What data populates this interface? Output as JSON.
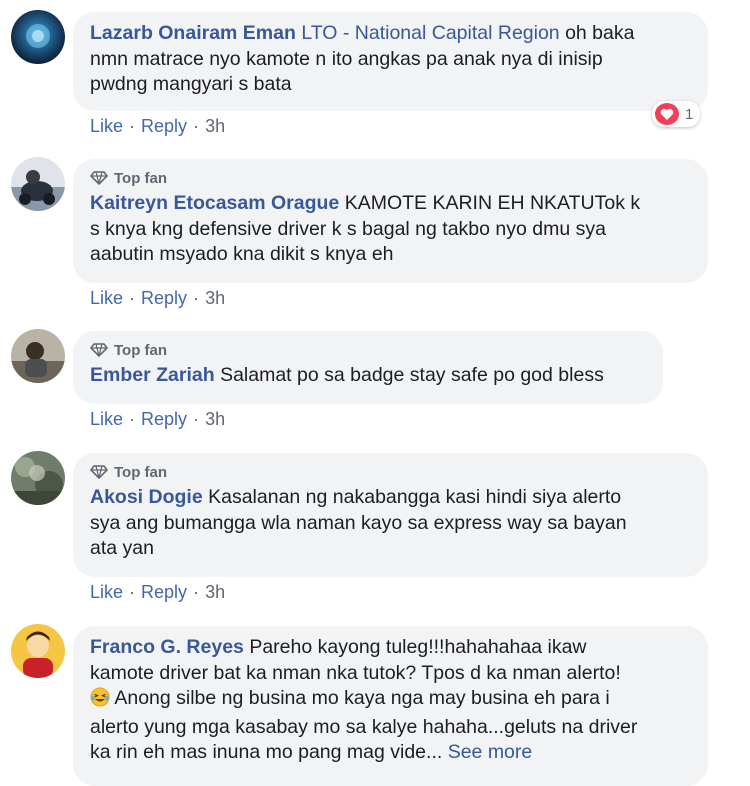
{
  "colors": {
    "link": "#385898",
    "action": "#4267b2",
    "meta": "#606770",
    "bubble": "#f2f3f5",
    "love": "#f33e58"
  },
  "comments": [
    {
      "author": "Lazarb Onairam Eman",
      "author_extra": "LTO - National Capital Region",
      "lines": [
        "oh baka",
        "nmn matrace nyo kamote n ito angkas pa anak nya di inisip",
        "pwdng mangyari s bata"
      ],
      "like": "Like",
      "reply": "Reply",
      "time": "3h",
      "reaction": {
        "icon": "heart-icon",
        "count": "1"
      }
    },
    {
      "badge": "Top fan",
      "author": "Kaitreyn Etocasam Orague",
      "lines": [
        "KAMOTE KARIN EH NKATUTok k",
        "s knya kng defensive driver k s bagal ng takbo nyo dmu sya",
        "aabutin msyado kna dikit s knya eh"
      ],
      "like": "Like",
      "reply": "Reply",
      "time": "3h"
    },
    {
      "badge": "Top fan",
      "author": "Ember Zariah",
      "lines": [
        "Salamat po sa badge stay safe po god bless"
      ],
      "like": "Like",
      "reply": "Reply",
      "time": "3h"
    },
    {
      "badge": "Top fan",
      "author": "Akosi Dogie",
      "lines": [
        "Kasalanan ng nakabangga kasi hindi siya alerto",
        "sya ang bumangga wla naman kayo sa express way sa bayan",
        "ata yan"
      ],
      "like": "Like",
      "reply": "Reply",
      "time": "3h"
    },
    {
      "author": "Franco G. Reyes",
      "lines": [
        "Pareho kayong tuleg!!!hahahahaa ikaw",
        "kamote driver bat ka nman nka tutok? Tpos d ka nman alerto!",
        "Anong silbe ng businа mo kaya nga may busina eh para i",
        "alerto yung mga kasabay mo sa kalye hahaha...geluts na driver",
        "ka rin eh mas inuna mo pang mag vide..."
      ],
      "see_more": "See more",
      "emoji_icon": "laughing-emoji-icon"
    }
  ]
}
